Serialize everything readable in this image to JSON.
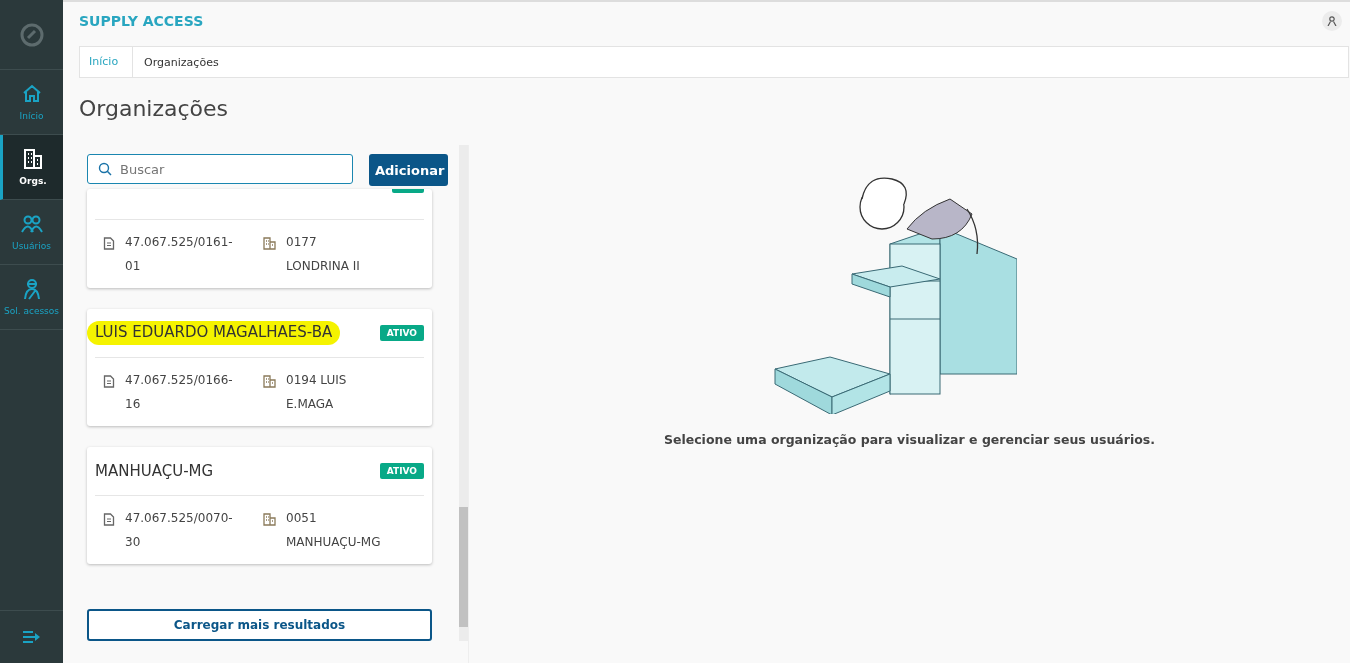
{
  "sidebar": {
    "items": [
      {
        "label": "Início",
        "selected": false
      },
      {
        "label": "Orgs.",
        "selected": true
      },
      {
        "label": "Usuários",
        "selected": false
      },
      {
        "label": "Sol. acessos",
        "selected": false
      }
    ]
  },
  "header": {
    "title": "SUPPLY ACCESS"
  },
  "breadcrumb": [
    {
      "label": "Início",
      "link": true
    },
    {
      "label": "Organizações",
      "link": false
    }
  ],
  "page_title": "Organizações",
  "search": {
    "placeholder": "Buscar"
  },
  "add_button": "Adicionar",
  "organizations": [
    {
      "kind": "partial",
      "cnpj": "47.067.525/0161-01",
      "branch": "0177 LONDRINA II"
    },
    {
      "kind": "full",
      "name": "LUIS EDUARDO MAGALHAES-BA",
      "highlighted": true,
      "status": "ATIVO",
      "cnpj": "47.067.525/0166-16",
      "branch": "0194 LUIS E.MAGA"
    },
    {
      "kind": "full",
      "name": "MANHUAÇU-MG",
      "highlighted": false,
      "status": "ATIVO",
      "cnpj": "47.067.525/0070-30",
      "branch": "0051 MANHUAÇU-MG"
    }
  ],
  "load_more": "Carregar mais resultados",
  "empty_state": {
    "message": "Selecione uma organização para visualizar e gerenciar seus usuários."
  }
}
